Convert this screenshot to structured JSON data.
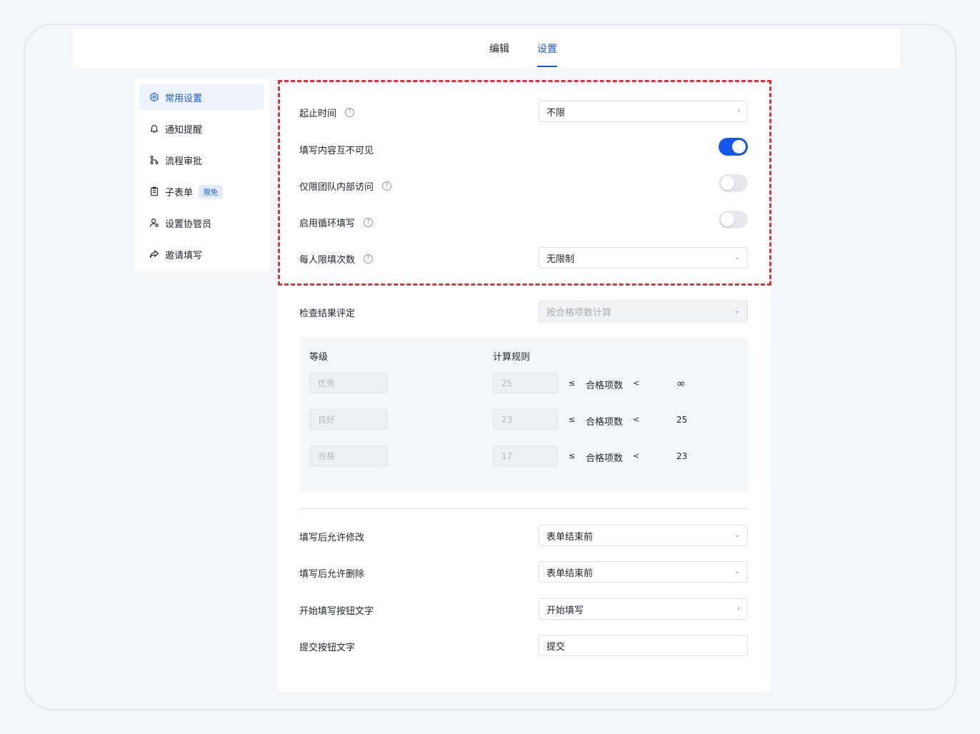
{
  "tabs": [
    {
      "label": "编辑",
      "active": false
    },
    {
      "label": "设置",
      "active": true
    }
  ],
  "accent_color": "#1456f0",
  "highlight_color": "#e5303a",
  "sidebar": {
    "items": [
      {
        "label": "常用设置",
        "icon": "gear-icon",
        "active": true
      },
      {
        "label": "通知提醒",
        "icon": "bell-icon"
      },
      {
        "label": "流程审批",
        "icon": "flow-icon"
      },
      {
        "label": "子表单",
        "icon": "clipboard-icon",
        "badge": "限免"
      },
      {
        "label": "设置协管员",
        "icon": "user-gear-icon"
      },
      {
        "label": "邀请填写",
        "icon": "share-icon"
      }
    ]
  },
  "settings": {
    "start_end_time": {
      "label": "起止时间",
      "value": "不限"
    },
    "content_invisible": {
      "label": "填写内容互不可见",
      "enabled": true
    },
    "team_only": {
      "label": "仅限团队内部访问",
      "enabled": false
    },
    "loop_fill": {
      "label": "启用循环填写",
      "enabled": false
    },
    "fill_limit": {
      "label": "每人限填次数",
      "value": "无限制"
    },
    "check_result": {
      "label": "检查结果评定",
      "value": "按合格项数计算"
    },
    "allow_modify": {
      "label": "填写后允许修改",
      "value": "表单结束前"
    },
    "allow_delete": {
      "label": "填写后允许删除",
      "value": "表单结束前"
    },
    "start_button_text": {
      "label": "开始填写按钮文字",
      "value": "开始填写"
    },
    "submit_button_text": {
      "label": "提交按钮文字",
      "value": "提交"
    }
  },
  "grades": {
    "header_level": "等级",
    "header_rule": "计算规则",
    "rows": [
      {
        "name": "优秀",
        "min": "25",
        "le": "≤",
        "metric": "合格项数",
        "lt": "<",
        "max": "∞"
      },
      {
        "name": "良好",
        "min": "23",
        "le": "≤",
        "metric": "合格项数",
        "lt": "<",
        "max": "25"
      },
      {
        "name": "合格",
        "min": "17",
        "le": "≤",
        "metric": "合格项数",
        "lt": "<",
        "max": "23"
      }
    ]
  }
}
